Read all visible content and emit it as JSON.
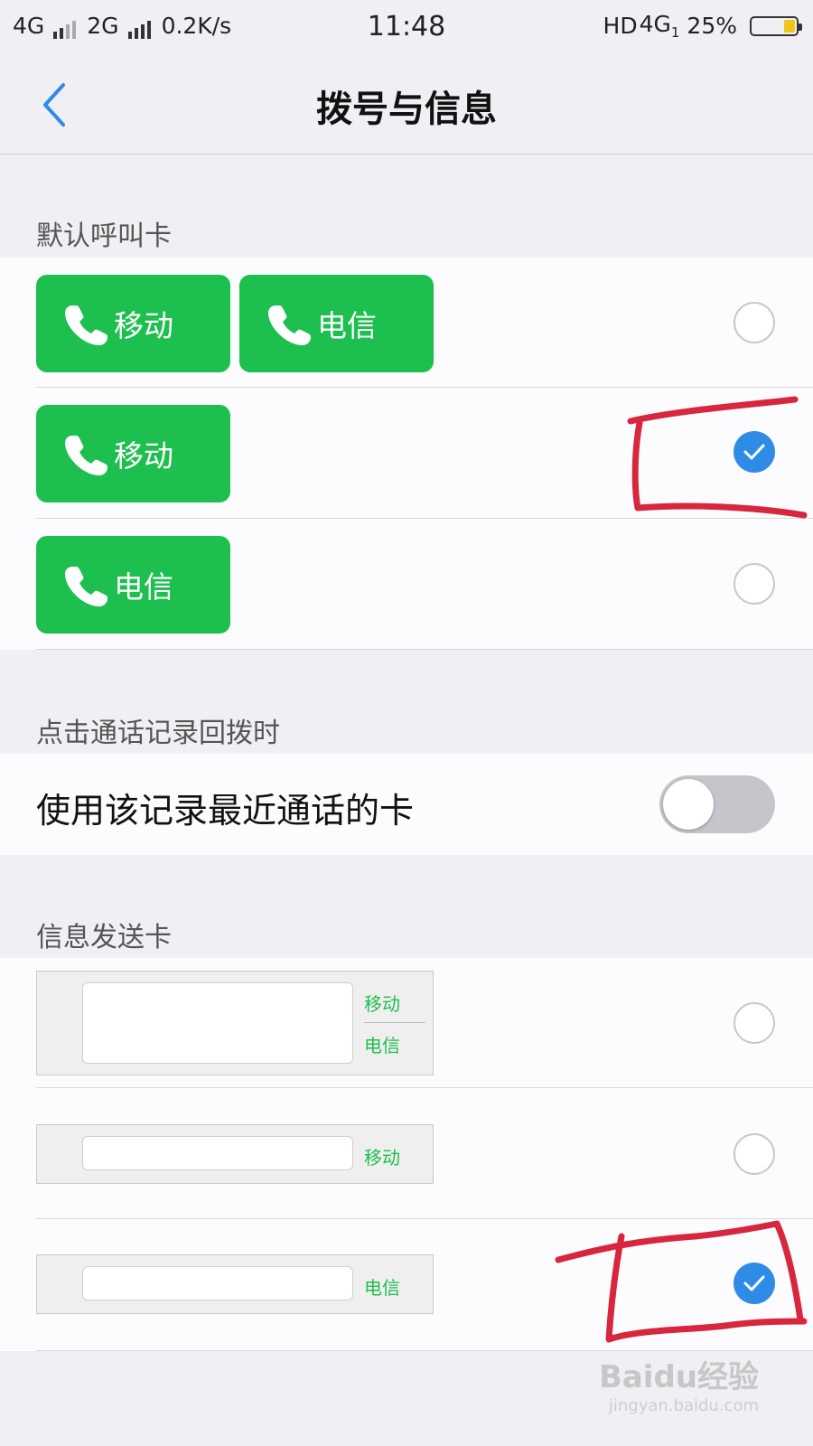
{
  "status_bar": {
    "sim1_net": "4G",
    "sim2_net": "2G",
    "speed": "0.2K/s",
    "time": "11:48",
    "hd": "HD",
    "net_right": "4G",
    "net_right_sub": "1",
    "battery": "25%",
    "battery_level": 0.25
  },
  "nav": {
    "title": "拨号与信息"
  },
  "call_section": {
    "label": "默认呼叫卡",
    "options": [
      {
        "cards": [
          "移动",
          "电信"
        ],
        "selected": false
      },
      {
        "cards": [
          "移动"
        ],
        "selected": true
      },
      {
        "cards": [
          "电信"
        ],
        "selected": false
      }
    ]
  },
  "callback_section": {
    "label": "点击通话记录回拨时",
    "toggle_label": "使用该记录最近通话的卡",
    "toggle_on": false
  },
  "message_section": {
    "label": "信息发送卡",
    "options": [
      {
        "labels": [
          "移动",
          "电信"
        ],
        "selected": false
      },
      {
        "labels": [
          "移动"
        ],
        "selected": false
      },
      {
        "labels": [
          "电信"
        ],
        "selected": true
      }
    ]
  },
  "watermark": {
    "brand": "Baidu经验",
    "url": "jingyan.baidu.com"
  },
  "colors": {
    "sim_green": "#1dbf4e",
    "radio_blue": "#2f8ce6",
    "annotation_red": "#d7263d",
    "back_blue": "#2f8ce6"
  }
}
